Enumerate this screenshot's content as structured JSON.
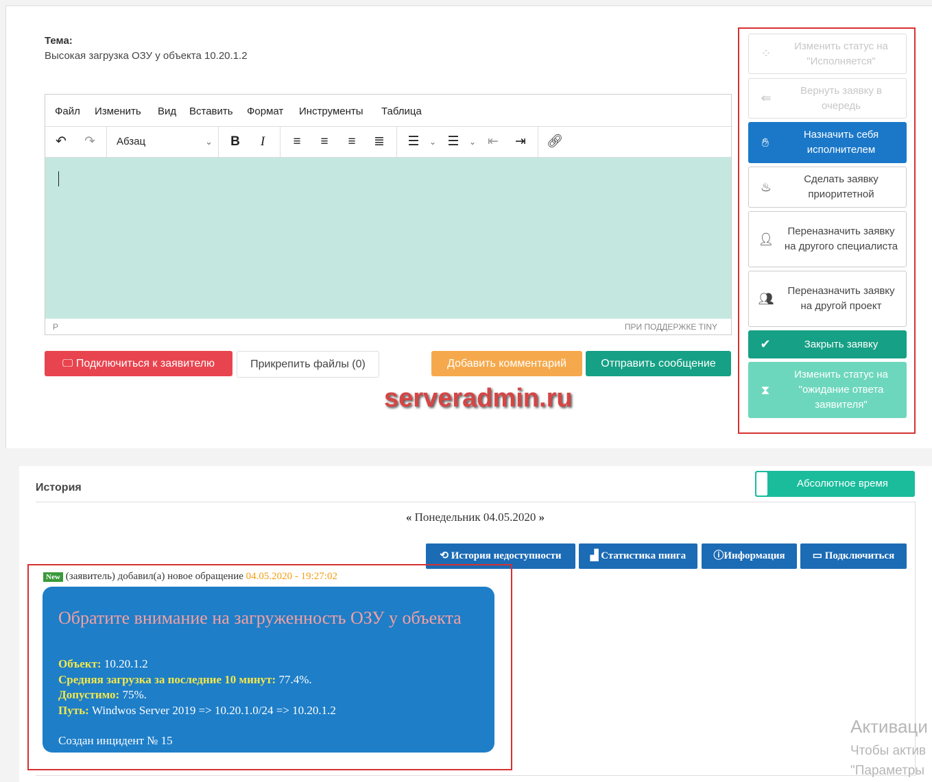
{
  "subject": {
    "label": "Тема:",
    "text": "Высокая загрузка ОЗУ у объекта 10.20.1.2"
  },
  "editor": {
    "menu": [
      "Файл",
      "Изменить",
      "Вид",
      "Вставить",
      "Формат",
      "Инструменты",
      "Таблица"
    ],
    "format_select": "Абзац",
    "status_path": "P",
    "powered_by": "ПРИ ПОДДЕРЖКЕ TINY"
  },
  "actions": {
    "connect": "Подключиться к заявителю",
    "attach": "Прикрепить файлы (0)",
    "add_comment": "Добавить комментарий",
    "send_message": "Отправить сообщение"
  },
  "sidebar": [
    {
      "label": "Изменить статус на \"Исполняется\"",
      "icon": "spinner-icon"
    },
    {
      "label": "Вернуть заявку в очередь",
      "icon": "reply-all-icon"
    },
    {
      "label": "Назначить себя исполнителем",
      "icon": "hand-icon"
    },
    {
      "label": "Сделать заявку приоритетной",
      "icon": "fire-icon"
    },
    {
      "label": "Переназначить заявку на другого специалиста",
      "icon": "user-icon"
    },
    {
      "label": "Переназначить заявку на другой проект",
      "icon": "users-icon"
    },
    {
      "label": "Закрыть заявку",
      "icon": "check-icon"
    },
    {
      "label": "Изменить статус на \"ожидание ответа заявителя\"",
      "icon": "hourglass-icon"
    }
  ],
  "watermark": "serveradmin.ru",
  "history": {
    "title": "История",
    "toggle_label": "Абсолютное время",
    "date": "Понедельник 04.05.2020",
    "prev": "«",
    "next": "»",
    "buttons": [
      "История недоступности",
      "Статистика пинга",
      "Информация",
      "Подключиться"
    ],
    "event": {
      "badge": "New",
      "text": "(заявитель) добавил(а) новое обращение",
      "time": "04.05.2020 - 19:27:02",
      "title": "Обратите внимание на загруженность ОЗУ у объекта",
      "object_label": "Объект:",
      "object_value": "10.20.1.2",
      "avg_label": "Средняя загрузка за последние 10 минут:",
      "avg_value": "77.4%.",
      "allowed_label": "Допустимо:",
      "allowed_value": "75%.",
      "path_label": "Путь:",
      "path_value": "Windwos Server 2019 => 10.20.1.0/24 => 10.20.1.2",
      "footer": "Создан инцидент № 15"
    }
  },
  "os_overlay": {
    "title": "Активаци",
    "line1": "Чтобы актив",
    "line2": "\"Параметры"
  }
}
